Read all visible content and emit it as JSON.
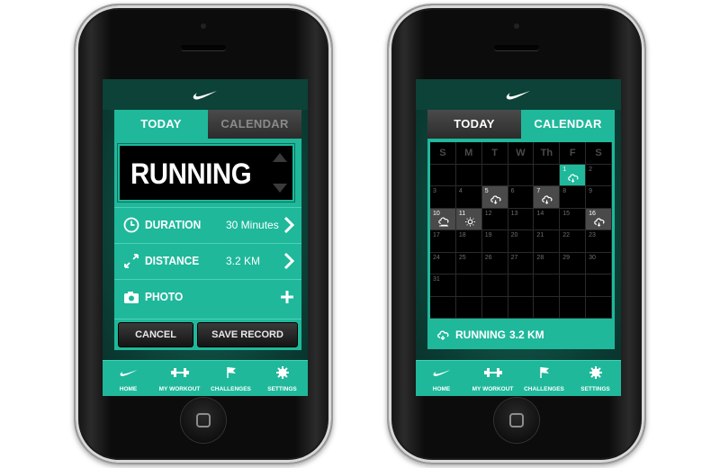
{
  "colors": {
    "accent": "#1fb89b",
    "dark": "#000000",
    "tab_inactive": "#3a3a3a"
  },
  "left_screen": {
    "tabs": [
      {
        "label": "TODAY",
        "active": true
      },
      {
        "label": "CALENDAR",
        "active": false
      }
    ],
    "activity": "RUNNING",
    "rows": [
      {
        "icon": "clock-icon",
        "label": "DURATION",
        "value": "30 Minutes",
        "action": "chevron-right-icon"
      },
      {
        "icon": "distance-arrows-icon",
        "label": "DISTANCE",
        "value": "3.2 KM",
        "action": "chevron-right-icon"
      },
      {
        "icon": "camera-icon",
        "label": "PHOTO",
        "value": "",
        "action": "plus-icon"
      }
    ],
    "buttons": {
      "cancel": "CANCEL",
      "save": "SAVE RECORD"
    }
  },
  "right_screen": {
    "tabs": [
      {
        "label": "TODAY",
        "active": false
      },
      {
        "label": "CALENDAR",
        "active": true
      }
    ],
    "weekdays": [
      "S",
      "M",
      "T",
      "W",
      "Th",
      "F",
      "S"
    ],
    "days": [
      {
        "n": "1",
        "state": "teal",
        "icon": "run-cloud-icon"
      },
      {
        "n": "2"
      },
      {
        "n": "3"
      },
      {
        "n": "4"
      },
      {
        "n": "5",
        "state": "grey",
        "icon": "run-cloud-icon"
      },
      {
        "n": "6"
      },
      {
        "n": "7",
        "state": "grey",
        "icon": "run-cloud-icon"
      },
      {
        "n": "8"
      },
      {
        "n": "9"
      },
      {
        "n": "10",
        "state": "grey",
        "icon": "bike-cloud-icon"
      },
      {
        "n": "11",
        "state": "grey",
        "icon": "sun-icon"
      },
      {
        "n": "12"
      },
      {
        "n": "13"
      },
      {
        "n": "14"
      },
      {
        "n": "15"
      },
      {
        "n": "16",
        "state": "grey",
        "icon": "run-cloud-icon"
      },
      {
        "n": "17"
      },
      {
        "n": "18"
      },
      {
        "n": "19"
      },
      {
        "n": "20"
      },
      {
        "n": "21"
      },
      {
        "n": "22"
      },
      {
        "n": "23"
      },
      {
        "n": "24"
      },
      {
        "n": "25"
      },
      {
        "n": "26"
      },
      {
        "n": "27"
      },
      {
        "n": "28"
      },
      {
        "n": "29"
      },
      {
        "n": "30"
      },
      {
        "n": "31"
      }
    ],
    "summary": {
      "icon": "run-cloud-icon",
      "label": "RUNNING",
      "value": "3.2 KM"
    }
  },
  "tabbar": [
    {
      "icon": "nike-swoosh-icon",
      "label": "HOME"
    },
    {
      "icon": "dumbbell-icon",
      "label": "MY WORKOUT"
    },
    {
      "icon": "flag-icon",
      "label": "CHALLENGES"
    },
    {
      "icon": "gear-icon",
      "label": "SETTINGS"
    }
  ]
}
